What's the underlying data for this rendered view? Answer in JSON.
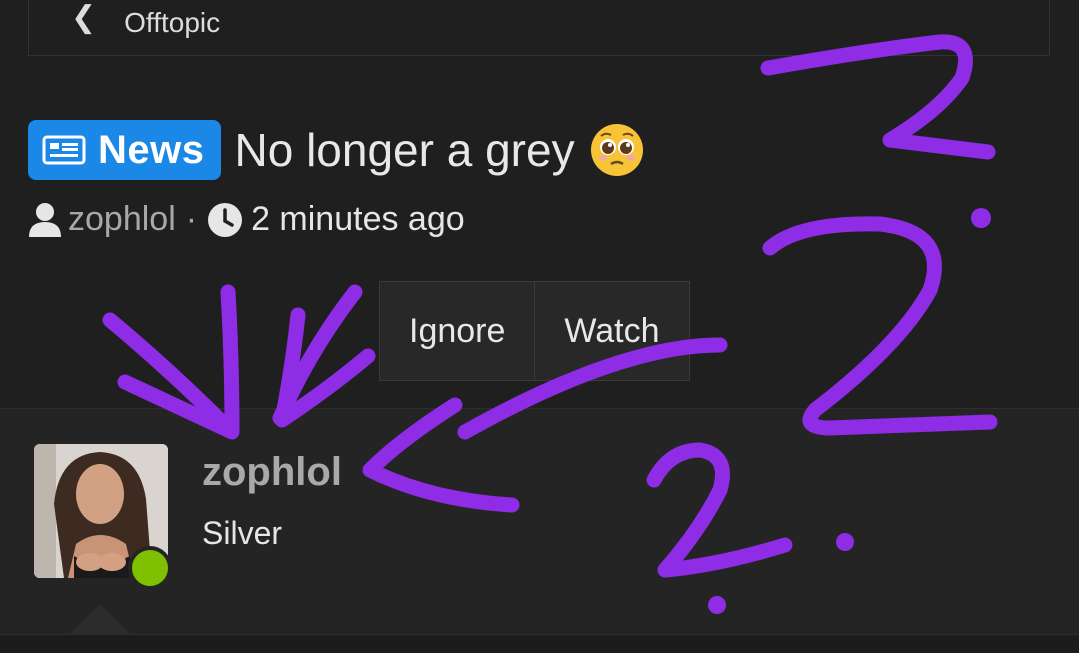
{
  "breadcrumb": {
    "back_icon": "chevron-left-icon",
    "label": "Offtopic"
  },
  "thread": {
    "prefix": {
      "label": "News",
      "icon": "newspaper-icon",
      "color": "#1b87e6"
    },
    "title": "No longer a grey",
    "title_emoji": "pleading-face-icon",
    "author": "zophlol",
    "separator": "·",
    "time": "2 minutes ago"
  },
  "actions": {
    "ignore_label": "Ignore",
    "watch_label": "Watch"
  },
  "post": {
    "username": "zophlol",
    "rank": "Silver",
    "online_color": "#7ec000"
  },
  "annotation": {
    "color": "#8e2ce6"
  }
}
